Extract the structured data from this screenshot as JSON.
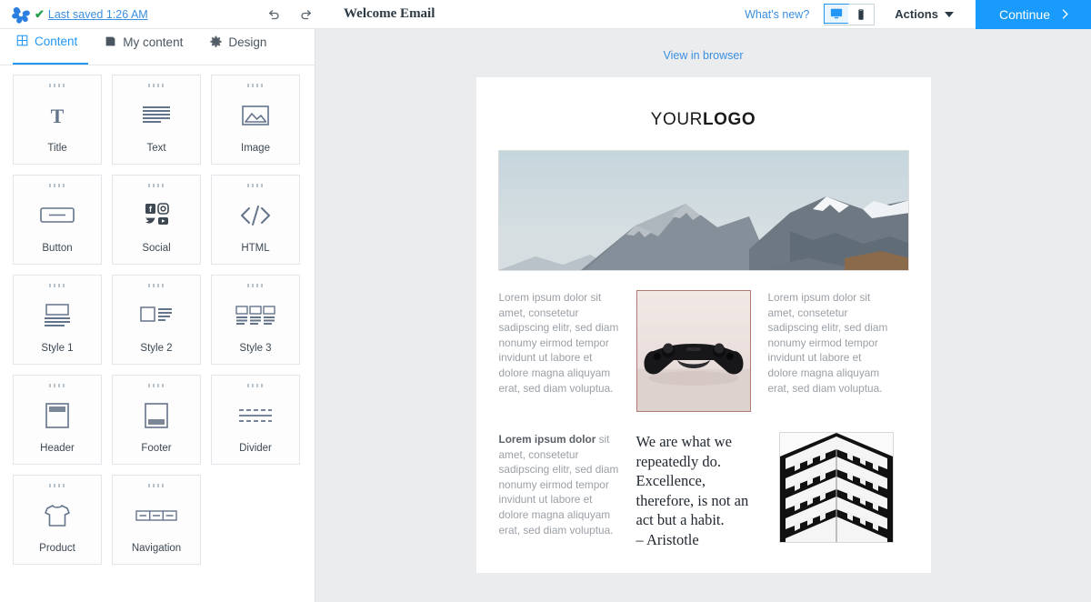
{
  "topbar": {
    "logo_icon": "pinwheel-logo-icon",
    "saved_check_icon": "checkmark-icon",
    "saved_text": "Last saved 1:26 AM",
    "undo_icon": "undo-icon",
    "redo_icon": "redo-icon",
    "document_title": "Welcome Email",
    "whats_new": "What's new?",
    "desktop_icon": "desktop-monitor-icon",
    "mobile_icon": "mobile-phone-icon",
    "active_view": "desktop",
    "actions_label": "Actions",
    "continue_label": "Continue",
    "continue_icon": "chevron-right-icon",
    "accent_blue": "#189bfc",
    "link_blue": "#3a8fe0",
    "check_green": "#22a14a"
  },
  "sidebar": {
    "tabs": [
      {
        "label": "Content",
        "icon": "grid-icon",
        "active": true
      },
      {
        "label": "My content",
        "icon": "save-disk-icon",
        "active": false
      },
      {
        "label": "Design",
        "icon": "gear-icon",
        "active": false
      }
    ],
    "blocks": [
      {
        "label": "Title",
        "icon": "title-T-icon"
      },
      {
        "label": "Text",
        "icon": "text-lines-icon"
      },
      {
        "label": "Image",
        "icon": "image-picture-icon"
      },
      {
        "label": "Button",
        "icon": "button-icon"
      },
      {
        "label": "Social",
        "icon": "social-networks-icon"
      },
      {
        "label": "HTML",
        "icon": "code-brackets-icon"
      },
      {
        "label": "Style 1",
        "icon": "style-1-icon"
      },
      {
        "label": "Style 2",
        "icon": "style-2-icon"
      },
      {
        "label": "Style 3",
        "icon": "style-3-icon"
      },
      {
        "label": "Header",
        "icon": "header-block-icon"
      },
      {
        "label": "Footer",
        "icon": "footer-block-icon"
      },
      {
        "label": "Divider",
        "icon": "divider-icon"
      },
      {
        "label": "Product",
        "icon": "tshirt-product-icon"
      },
      {
        "label": "Navigation",
        "icon": "navigation-bar-icon"
      }
    ],
    "drag_handle_icon": "drag-dots-icon"
  },
  "canvas": {
    "view_in_browser": "View in browser",
    "email": {
      "logo_light": "YOUR",
      "logo_bold": "LOGO",
      "hero_image_alt": "snow-capped-mountains-photo",
      "columns_row_1": {
        "left_text": "Lorem ipsum dolor sit amet, consetetur sadipscing elitr, sed diam nonumy eirmod tempor invidunt ut labore et dolore magna aliquyam erat, sed diam voluptua.",
        "center_image_alt": "game-controller-photo",
        "right_text": "Lorem ipsum dolor sit amet, consetetur sadipscing elitr, sed diam nonumy eirmod tempor invidunt ut labore et dolore magna aliquyam erat, sed diam voluptua."
      },
      "columns_row_2": {
        "left_text_bold": "Lorem ipsum dolor",
        "left_text": " sit amet, consetetur sadipscing elitr, sed diam nonumy eirmod tempor invidunt ut labore et dolore magna aliquyam erat, sed diam voluptua.",
        "quote": "We are what we repeatedly do. Excellence, therefore, is not an act but a habit.",
        "quote_author": "– Aristotle",
        "right_image_alt": "black-and-white-building-photo"
      }
    }
  }
}
